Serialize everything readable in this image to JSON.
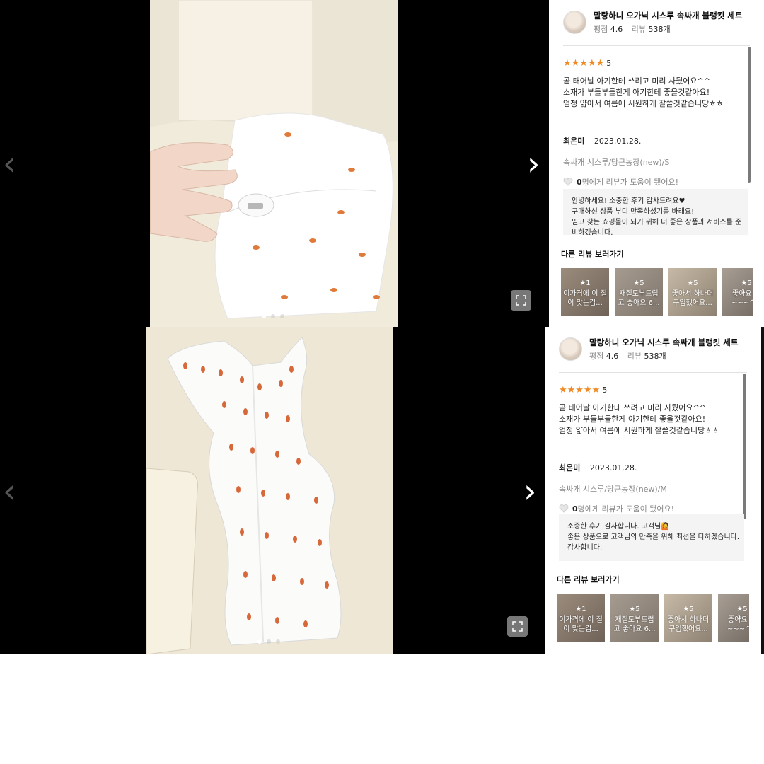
{
  "panels": [
    {
      "product": {
        "name": "말랑하니 오가닉 시스루 속싸개 블랭킷 세트",
        "rating_label": "평점",
        "rating": "4.6",
        "review_label": "리뷰",
        "review_count": "538개"
      },
      "review": {
        "stars": "★★★★★",
        "score": "5",
        "lines": [
          "곧 태어날 아기한테 쓰려고 미리 사뒀어요^^",
          "소재가 부들부들한게 아기한테 좋을것같아요!",
          "엄청 얇아서 여름에 시원하게 잘쓸것같습니당ㅎㅎ"
        ],
        "author": "최은미",
        "date": "2023.01.28.",
        "option": "속싸개 시스루/당근농장(new)/S",
        "helpful_count": "0",
        "helpful_text": "명에게 리뷰가 도움이 됐어요!"
      },
      "reply_lines": [
        "안녕하세요! 소중한 후기 감사드려요♥",
        "구매하신 상품 부디 만족하셨기를 바래요!",
        "믿고 찾는 쇼핑몰이 되기 위해 더 좋은 상품과 서비스를 준",
        "비하겠습니다."
      ],
      "more_title": "다른 리뷰 보러가기",
      "cards": [
        {
          "score": "1",
          "text": "이가격에 이 질이 맞는검..."
        },
        {
          "score": "5",
          "text": "재질도부드럽 고 좋아요 6..."
        },
        {
          "score": "5",
          "text": "좋아서 하나더 구입했어요..."
        },
        {
          "score": "5",
          "text": "좋아요 좋 ~~~^^"
        }
      ],
      "nav": {
        "prev": "‹",
        "next": "›"
      }
    },
    {
      "product": {
        "name": "말랑하니 오가닉 시스루 속싸개 블랭킷 세트",
        "rating_label": "평점",
        "rating": "4.6",
        "review_label": "리뷰",
        "review_count": "538개"
      },
      "review": {
        "stars": "★★★★★",
        "score": "5",
        "lines": [
          "곧 태어날 아기한테 쓰려고 미리 사뒀어요^^",
          "소재가 부들부들한게 아기한테 좋을것같아요!",
          "엄청 얇아서 여름에 시원하게 잘쓸것같습니당ㅎㅎ"
        ],
        "author": "최은미",
        "date": "2023.01.28.",
        "option": "속싸개 시스루/당근농장(new)/M",
        "helpful_count": "0",
        "helpful_text": "명에게 리뷰가 도움이 됐어요!"
      },
      "reply_lines": [
        "소중한 후기 감사합니다. 고객님🙋",
        "좋은 상품으로 고객님의 만족을 위해 최선을 다하겠습니다.",
        "감사합니다."
      ],
      "more_title": "다른 리뷰 보러가기",
      "cards": [
        {
          "score": "1",
          "text": "이가격에 이 질이 맞는검..."
        },
        {
          "score": "5",
          "text": "재질도부드럽 고 좋아요 6..."
        },
        {
          "score": "5",
          "text": "좋아서 하나더 구입했어요..."
        },
        {
          "score": "5",
          "text": "좋아요 좋 ~~~^^"
        }
      ],
      "nav": {
        "prev": "‹",
        "next": "›"
      }
    }
  ],
  "colors": {
    "star": "#f08a24",
    "viewer_bg": "#000000",
    "reply_bg": "#f4f4f4"
  },
  "icons": [
    "chevron-left-icon",
    "chevron-right-icon",
    "expand-icon",
    "star-icon",
    "heart-icon"
  ]
}
